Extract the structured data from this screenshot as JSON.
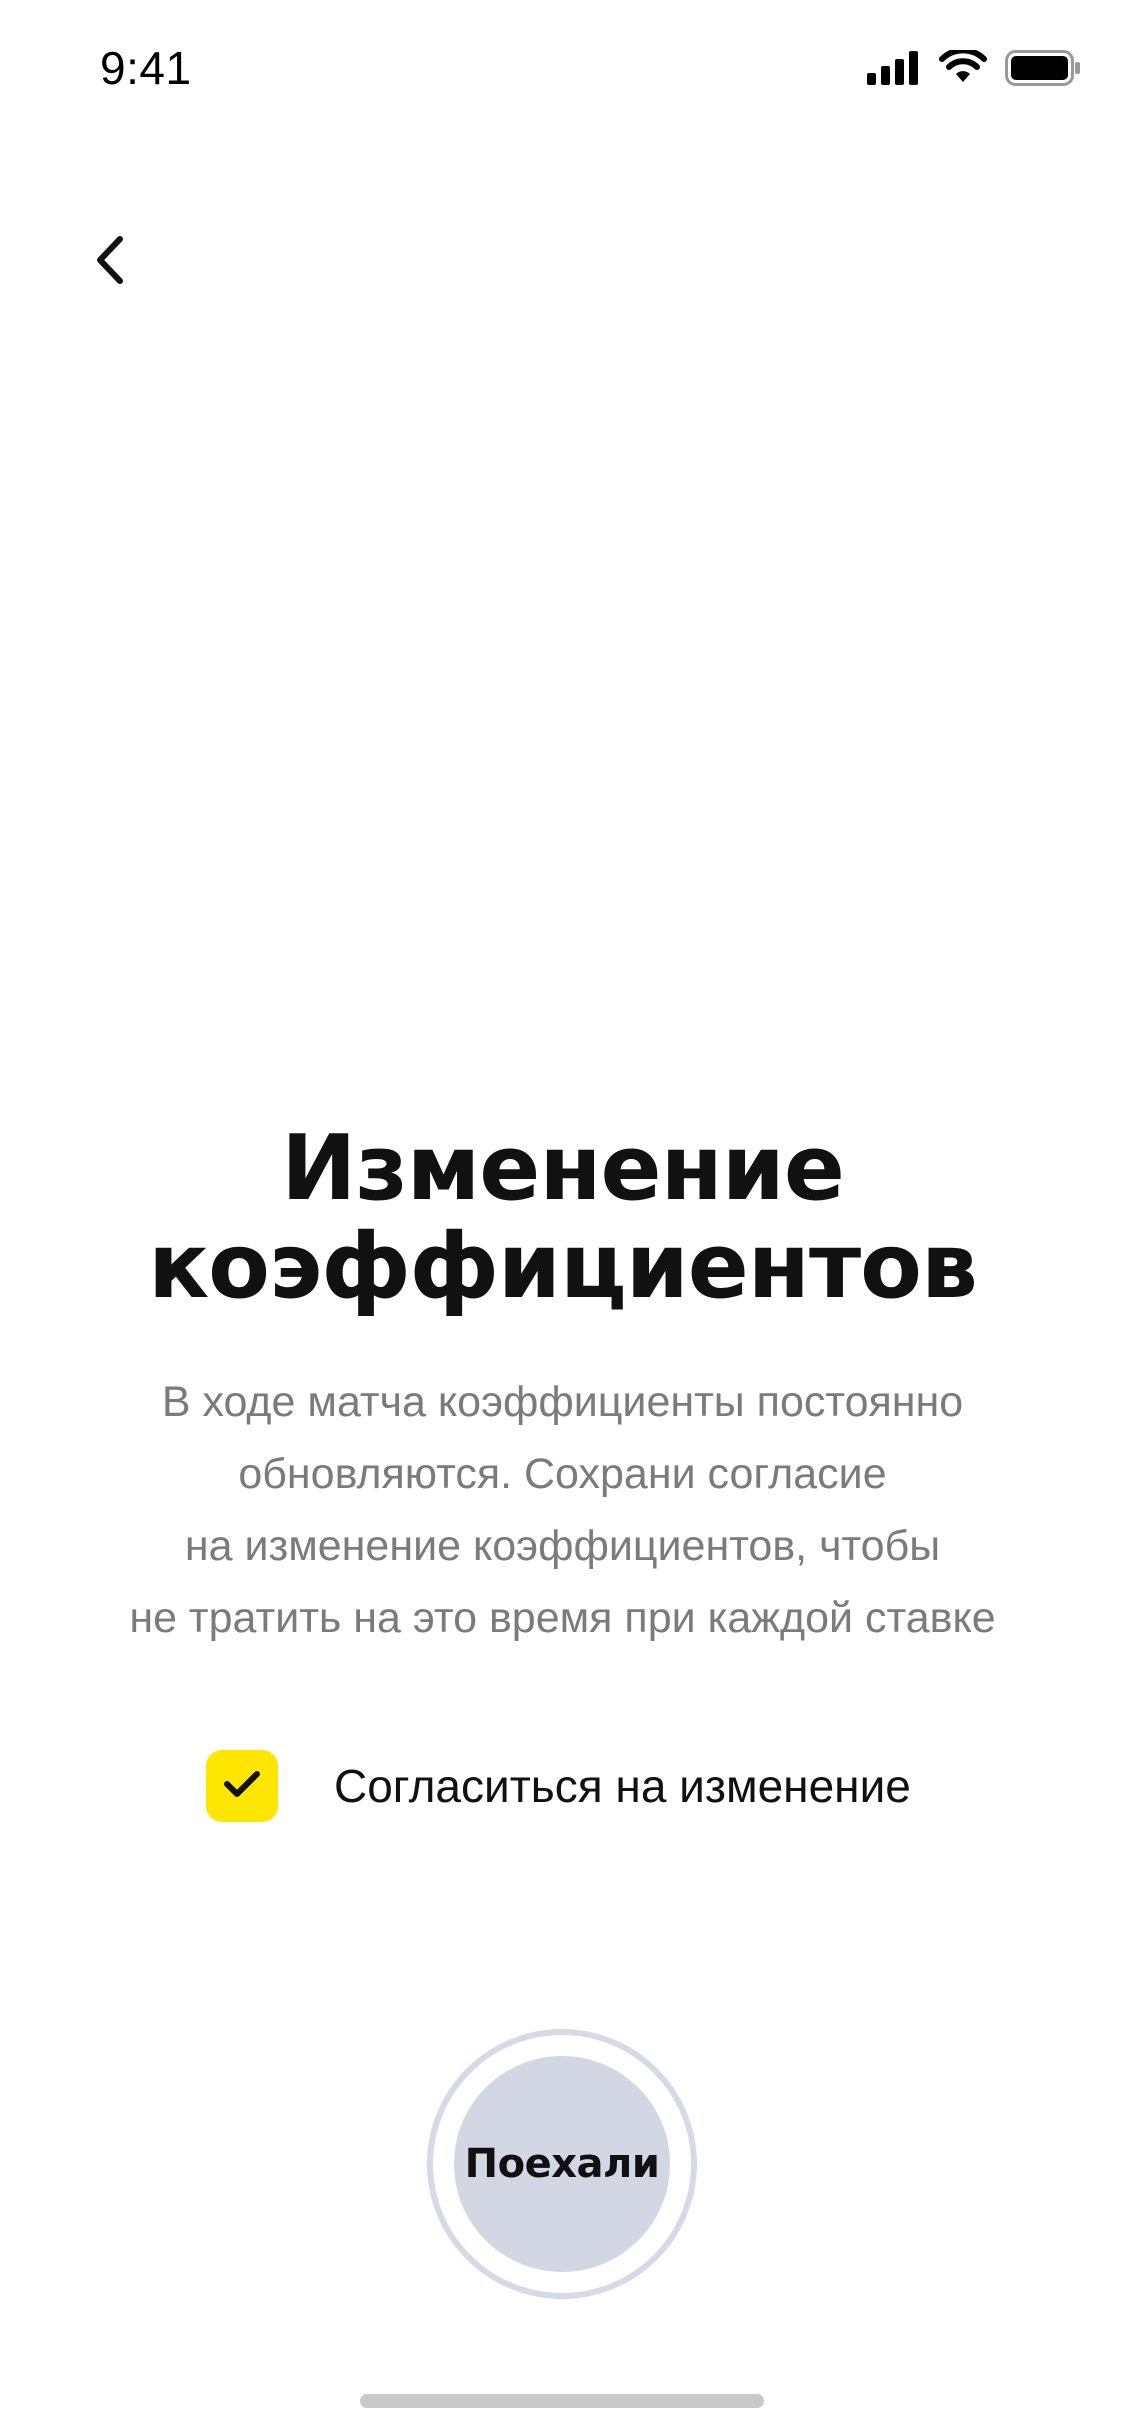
{
  "status_bar": {
    "time": "9:41",
    "icons": [
      "cellular-signal-icon",
      "wifi-icon",
      "battery-icon"
    ]
  },
  "navigation": {
    "back_icon": "chevron-left-icon"
  },
  "screen": {
    "title_lines": [
      "Изменение",
      "коэффициентов"
    ],
    "description_lines": [
      "В ходе матча коэффициенты постоянно",
      "обновляются. Сохрани согласие",
      "на изменение коэффициентов, чтобы",
      "не тратить на это время при каждой ставке"
    ]
  },
  "agreement": {
    "label": "Согласиться на изменение",
    "checked": true,
    "checkbox_color": "#FFE600",
    "check_icon": "checkmark-icon"
  },
  "primary_action": {
    "label": "Поехали",
    "fill_color": "#D3D6E3",
    "ring_color": "#D6D9E6"
  }
}
